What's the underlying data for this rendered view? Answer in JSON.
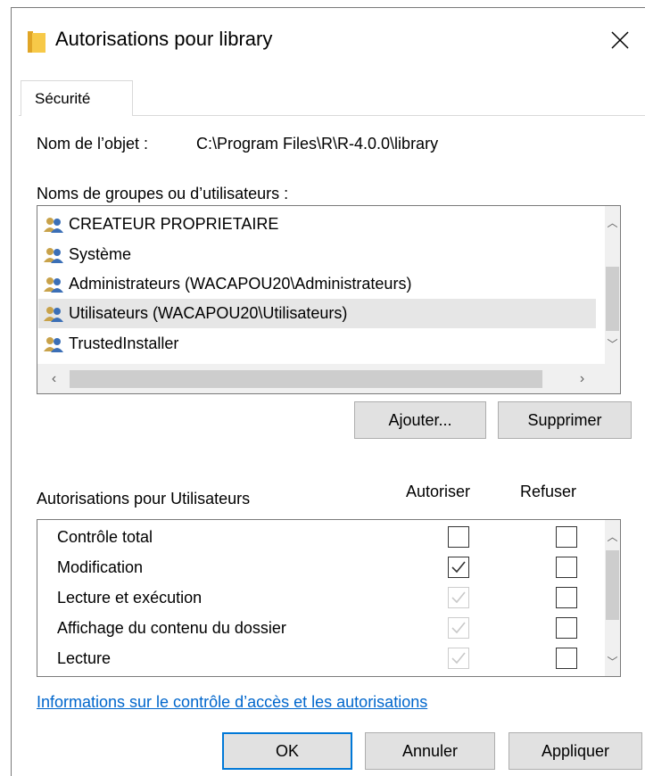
{
  "window": {
    "title": "Autorisations pour library",
    "close_glyph": "✕"
  },
  "tabs": [
    {
      "label": "Sécurité",
      "selected": true
    }
  ],
  "object": {
    "label": "Nom de l’objet :",
    "value": "C:\\Program Files\\R\\R-4.0.0\\library"
  },
  "groups": {
    "label": "Noms de groupes ou d’utilisateurs :",
    "items": [
      {
        "label": "CREATEUR PROPRIETAIRE",
        "icon": "users-group-icon"
      },
      {
        "label": "Système",
        "icon": "users-group-icon"
      },
      {
        "label": "Administrateurs (WACAPOU20\\Administrateurs)",
        "icon": "users-group-icon"
      },
      {
        "label": "Utilisateurs (WACAPOU20\\Utilisateurs)",
        "icon": "users-group-icon",
        "selected": true
      },
      {
        "label": "TrustedInstaller",
        "icon": "users-group-icon"
      }
    ],
    "add_label": "Ajouter...",
    "remove_label": "Supprimer"
  },
  "permissions": {
    "label": "Autorisations pour Utilisateurs",
    "allow_header": "Autoriser",
    "deny_header": "Refuser",
    "items": [
      {
        "label": "Contrôle total",
        "allow": false,
        "allow_inherited": false,
        "deny": false
      },
      {
        "label": "Modification",
        "allow": true,
        "allow_inherited": false,
        "deny": false
      },
      {
        "label": "Lecture et exécution",
        "allow": true,
        "allow_inherited": true,
        "deny": false
      },
      {
        "label": "Affichage du contenu du dossier",
        "allow": true,
        "allow_inherited": true,
        "deny": false
      },
      {
        "label": "Lecture",
        "allow": true,
        "allow_inherited": true,
        "deny": false
      }
    ]
  },
  "info_link": "Informations sur le contrôle d’accès et les autorisations",
  "footer": {
    "ok_label": "OK",
    "cancel_label": "Annuler",
    "apply_label": "Appliquer"
  },
  "colors": {
    "accent": "#0078d7",
    "link": "#0066cc",
    "selection": "#e6e6e6",
    "folder": "#f2c94c"
  }
}
